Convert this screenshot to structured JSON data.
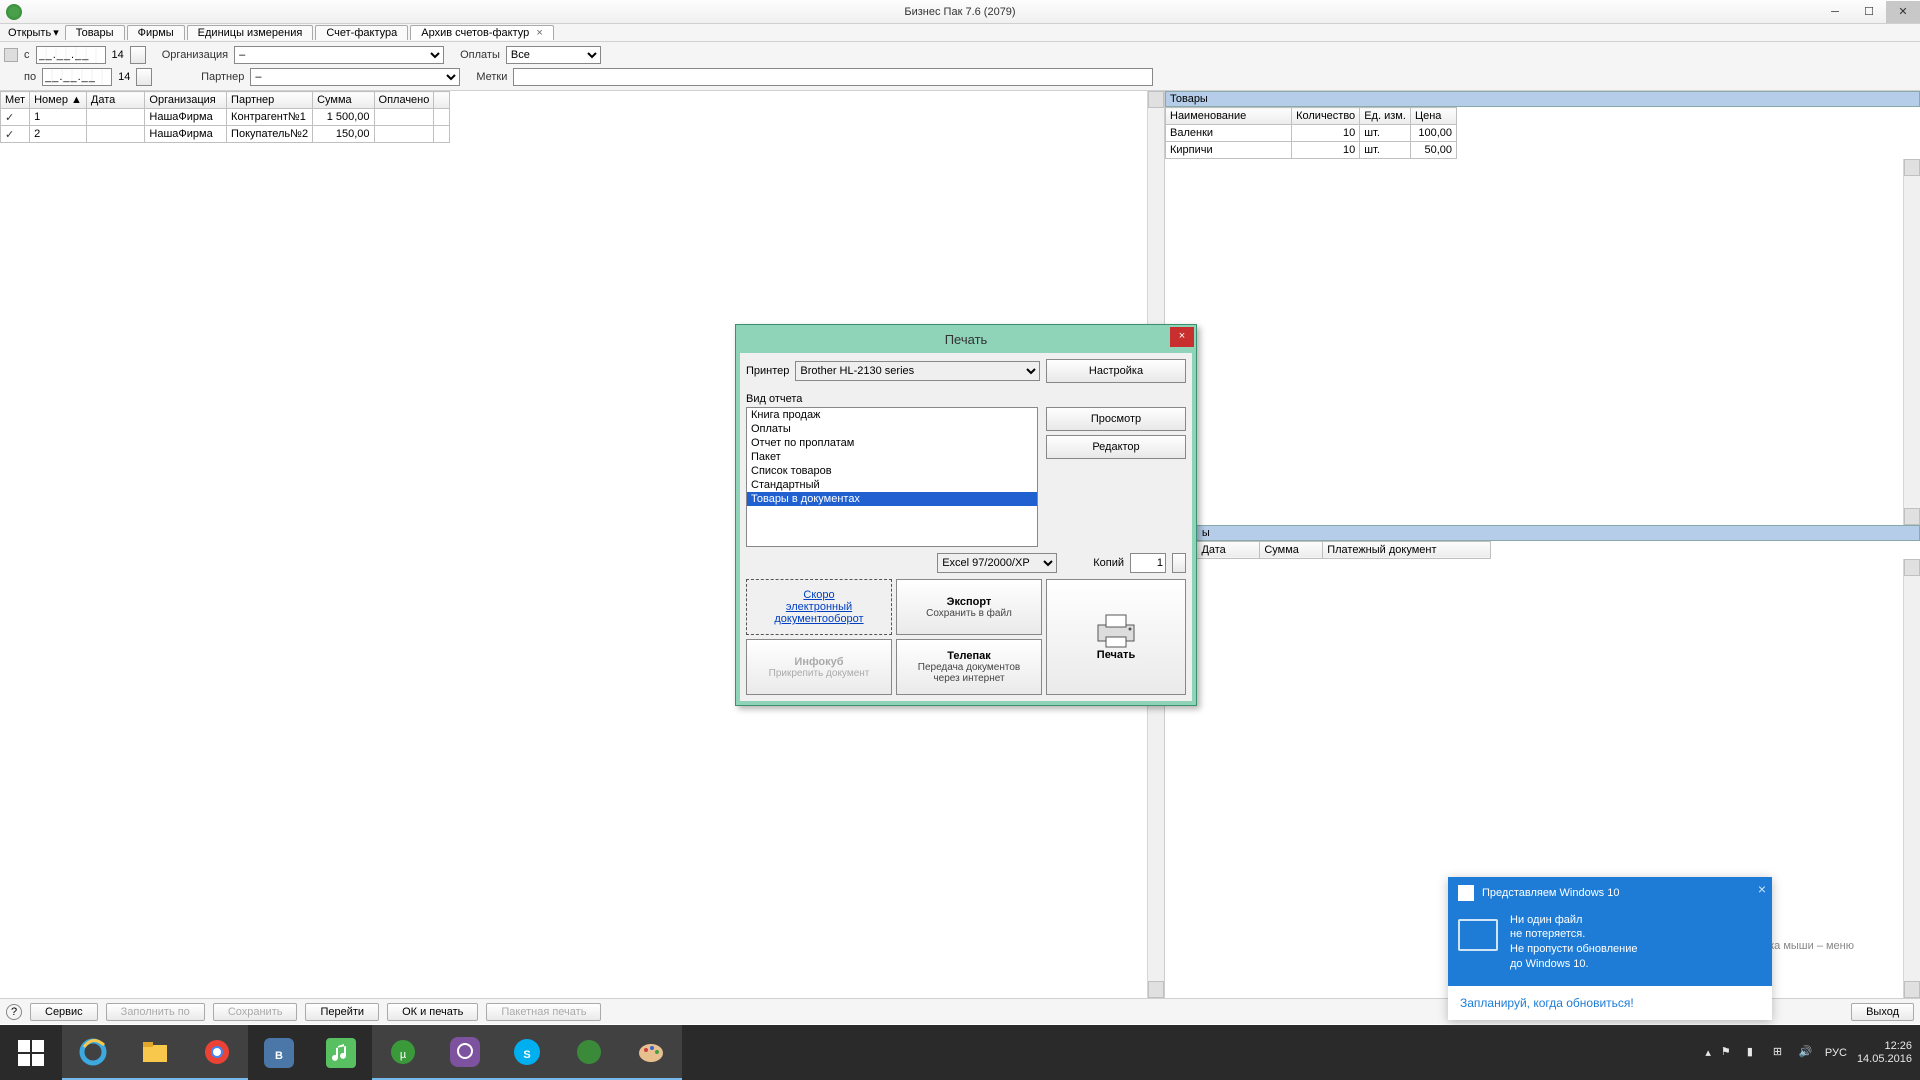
{
  "app": {
    "title": "Бизнес Пак 7.6 (2079)"
  },
  "menu": {
    "open": "Открыть",
    "tabs": [
      "Товары",
      "Фирмы",
      "Единицы измерения",
      "Счет-фактура"
    ],
    "active_tab": "Архив счетов-фактур"
  },
  "filters": {
    "from_lbl": "с",
    "to_lbl": "по",
    "date_mask": "__.__.__",
    "year_sfx": "14",
    "org_lbl": "Организация",
    "org_val": "–",
    "partner_lbl": "Партнер",
    "partner_val": "–",
    "pay_lbl": "Оплаты",
    "pay_val": "Все",
    "marks_lbl": "Метки"
  },
  "left_grid": {
    "cols": [
      "Мет",
      "Номер ▲",
      "Дата",
      "Организация",
      "Партнер",
      "Сумма",
      "Оплачено"
    ],
    "rows": [
      {
        "chk": true,
        "num": "1",
        "date": "",
        "org": "НашаФирма",
        "partner": "Контрагент№1",
        "sum": "1 500,00",
        "paid": ""
      },
      {
        "chk": true,
        "num": "2",
        "date": "",
        "org": "НашаФирма",
        "partner": "Покупатель№2",
        "sum": "150,00",
        "paid": ""
      }
    ]
  },
  "goods": {
    "section": "Товары",
    "cols": [
      "Наименование",
      "Количество",
      "Ед. изм.",
      "Цена"
    ],
    "rows": [
      {
        "name": "Валенки",
        "qty": "10",
        "unit": "шт.",
        "price": "100,00"
      },
      {
        "name": "Кирпичи",
        "qty": "10",
        "unit": "шт.",
        "price": "50,00"
      }
    ]
  },
  "payments_grid": {
    "section_tail": "ы",
    "cols": [
      "▲",
      "Дата",
      "Сумма",
      "Платежный документ"
    ]
  },
  "right_hint": "Правая кнопка мыши – меню",
  "print": {
    "title": "Печать",
    "printer_lbl": "Принтер",
    "printer_val": "Brother HL-2130 series",
    "btn_settings": "Настройка",
    "section_lbl": "Вид отчета",
    "reports": [
      "Книга продаж",
      "Оплаты",
      "Отчет по проплатам",
      "Пакет",
      "Список товаров",
      "Стандартный",
      "Товары в документах"
    ],
    "selected_idx": 6,
    "btn_preview": "Просмотр",
    "btn_editor": "Редактор",
    "format": "Excel 97/2000/XP",
    "copies_lbl": "Копий",
    "copies_val": "1",
    "soon_l1": "Скоро",
    "soon_l2": "электронный",
    "soon_l3": "документооборот",
    "export_t": "Экспорт",
    "export_s": "Сохранить в файл",
    "telepak_t": "Телепак",
    "telepak_s1": "Передача документов",
    "telepak_s2": "через интернет",
    "infokub_t": "Инфокуб",
    "infokub_s": "Прикрепить документ",
    "btn_print": "Печать"
  },
  "status": {
    "service": "Сервис",
    "fill": "Заполнить по",
    "save": "Сохранить",
    "go": "Перейти",
    "ok_print": "ОК и печать",
    "batch": "Пакетная печать",
    "exit": "Выход"
  },
  "notif": {
    "hdr": "Представляем Windows 10",
    "l1": "Ни один файл",
    "l2": "не потеряется.",
    "l3": "Не пропусти обновление",
    "l4": "до Windows 10.",
    "foot": "Запланируй, когда обновиться!"
  },
  "tray": {
    "lang": "РУС",
    "time": "12:26",
    "date": "14.05.2016"
  },
  "colors": {
    "accent": "#1e7cd6",
    "dlg_frame": "#8fd4b8",
    "select": "#2060d0"
  }
}
